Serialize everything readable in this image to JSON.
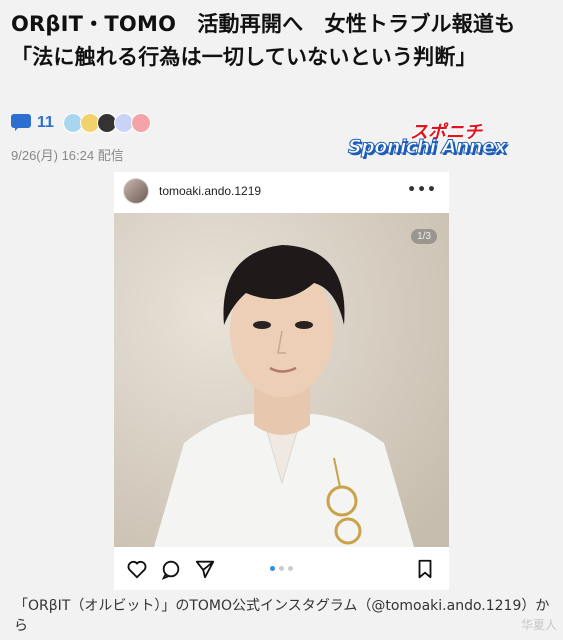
{
  "article": {
    "headline": "ORβIT・TOMO　活動再開へ　女性トラブル報道も「法に触れる行為は一切していないという判断」",
    "comment_count": "11",
    "timestamp": "9/26(月) 16:24 配信",
    "reactions": [
      {
        "icon": "reaction-smile-icon",
        "color": "#a9d6ef"
      },
      {
        "icon": "reaction-wink-icon",
        "color": "#f2d36b"
      },
      {
        "icon": "reaction-alien-icon",
        "color": "#333333"
      },
      {
        "icon": "reaction-think-icon",
        "color": "#c9d3f5"
      },
      {
        "icon": "reaction-angry-icon",
        "color": "#f4a3a8"
      }
    ]
  },
  "publisher": {
    "logo_top": "スポニチ",
    "logo_bottom": "Sponichi Annex",
    "accent_red": "#e3121b",
    "accent_blue": "#1d5db7"
  },
  "instagram": {
    "username": "tomoaki.ando.1219",
    "more_label": "•••",
    "page_indicator": "1/3",
    "carousel_active_index": 0,
    "carousel_count": 3
  },
  "caption": "「ORβIT（オルビット）」のTOMO公式インスタグラム（@tomoaki.ando.1219）から",
  "watermark": "华夏人",
  "colors": {
    "link_blue": "#2d6fd0",
    "background": "#f2f2f2"
  }
}
